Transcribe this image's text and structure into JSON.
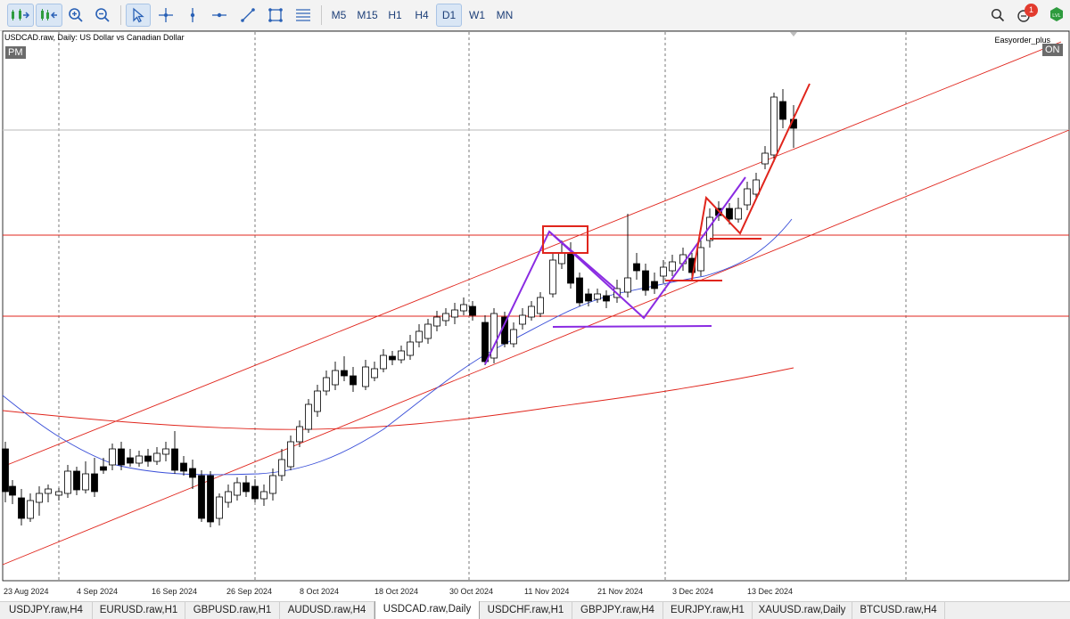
{
  "toolbar": {
    "tools": [
      {
        "name": "autoscroll-icon",
        "active": true
      },
      {
        "name": "chart-shift-icon",
        "active": true
      },
      {
        "name": "zoom-in-icon",
        "active": false
      },
      {
        "name": "zoom-out-icon",
        "active": false
      },
      {
        "name": "cursor-icon",
        "active": true
      },
      {
        "name": "crosshair-icon",
        "active": false
      },
      {
        "name": "vertical-line-icon",
        "active": false
      },
      {
        "name": "horizontal-line-icon",
        "active": false
      },
      {
        "name": "trendline-icon",
        "active": false
      },
      {
        "name": "rectangle-icon",
        "active": false
      },
      {
        "name": "fibonacci-icon",
        "active": false
      }
    ],
    "timeframes": [
      "M5",
      "M15",
      "H1",
      "H4",
      "D1",
      "W1",
      "MN"
    ],
    "active_timeframe": "D1",
    "notification_count": "1",
    "right_icons": [
      "search-icon",
      "notifications-icon",
      "signal-lvl-icon"
    ]
  },
  "chart": {
    "symbol_label": "USDCAD.raw, Daily:  US Dollar vs Canadian Dollar",
    "top_left_tag": "PM",
    "ea_label": "Easyorder_plus",
    "top_right_tag": "ON"
  },
  "chart_data": {
    "type": "candlestick",
    "title": "USDCAD.raw, Daily:  US Dollar vs Canadian Dollar",
    "x_tick_labels": [
      "23 Aug 2024",
      "4 Sep 2024",
      "16 Sep 2024",
      "26 Sep 2024",
      "8 Oct 2024",
      "18 Oct 2024",
      "30 Oct 2024",
      "11 Nov 2024",
      "21 Nov 2024",
      "3 Dec 2024",
      "13 Dec 2024"
    ],
    "grid": true,
    "colors": {
      "bull": "#ffffff",
      "bear": "#000000",
      "wick": "#000000",
      "trendline": "#e0251c",
      "pattern": "#8a2be2",
      "ma_fast": "#3a4fd8",
      "ma_slow": "#e0251c",
      "hline": "#e0251c"
    }
  },
  "tabs": [
    {
      "label": "USDJPY.raw,H4",
      "active": false
    },
    {
      "label": "EURUSD.raw,H1",
      "active": false
    },
    {
      "label": "GBPUSD.raw,H1",
      "active": false
    },
    {
      "label": "AUDUSD.raw,H4",
      "active": false
    },
    {
      "label": "USDCAD.raw,Daily",
      "active": true
    },
    {
      "label": "USDCHF.raw,H1",
      "active": false
    },
    {
      "label": "GBPJPY.raw,H4",
      "active": false
    },
    {
      "label": "EURJPY.raw,H1",
      "active": false
    },
    {
      "label": "XAUUSD.raw,Daily",
      "active": false
    },
    {
      "label": "BTCUSD.raw,H4",
      "active": false
    }
  ]
}
